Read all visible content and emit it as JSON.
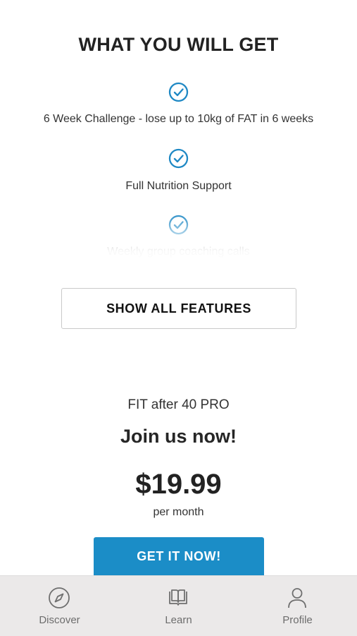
{
  "section": {
    "title": "WHAT YOU WILL GET",
    "features": [
      {
        "label": "6 Week Challenge - lose up to 10kg of FAT in 6 weeks",
        "icon": "check-circle-icon"
      },
      {
        "label": "Full Nutrition Support",
        "icon": "check-circle-icon"
      },
      {
        "label": "Weekly group coaching calls",
        "icon": "check-circle-icon"
      }
    ],
    "show_all_label": "SHOW ALL FEATURES"
  },
  "plan": {
    "name": "FIT after 40 PRO",
    "headline": "Join us now!",
    "price": "$19.99",
    "period": "per month",
    "cta_label": "GET IT NOW!"
  },
  "tabbar": {
    "items": [
      {
        "label": "Discover",
        "icon": "compass-icon"
      },
      {
        "label": "Learn",
        "icon": "book-icon"
      },
      {
        "label": "Profile",
        "icon": "user-icon"
      }
    ]
  },
  "colors": {
    "accent": "#1b8dc7",
    "check": "#1e88c4",
    "tabbar_bg": "#ebe9e9"
  }
}
